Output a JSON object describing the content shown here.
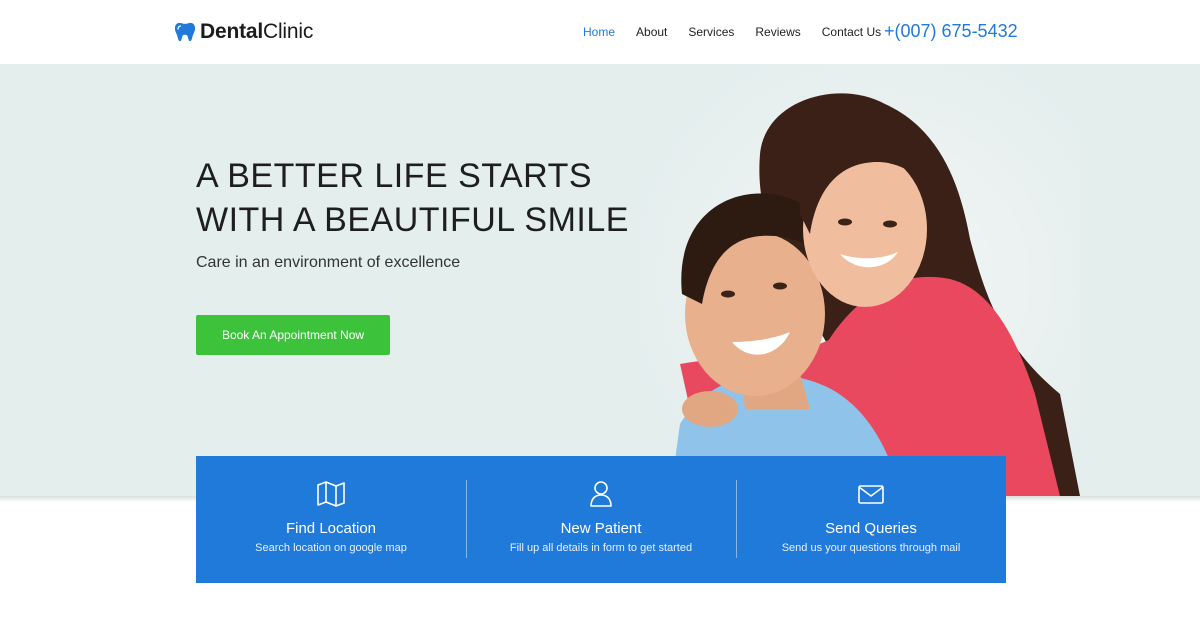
{
  "header": {
    "logo_bold": "Dental",
    "logo_light": "Clinic",
    "nav": [
      "Home",
      "About",
      "Services",
      "Reviews",
      "Contact Us"
    ],
    "phone": "+(007) 675-5432"
  },
  "hero": {
    "headline_line1": "A BETTER LIFE STARTS",
    "headline_line2": "WITH A BEAUTIFUL SMILE",
    "subline": "Care in an environment of excellence",
    "cta_label": "Book An Appointment Now"
  },
  "features": [
    {
      "icon": "map-icon",
      "title": "Find Location",
      "desc": "Search location on google map"
    },
    {
      "icon": "user-icon",
      "title": "New Patient",
      "desc": "Fill up all details in form to get started"
    },
    {
      "icon": "mail-icon",
      "title": "Send Queries",
      "desc": "Send us your questions through mail"
    }
  ],
  "colors": {
    "accent": "#1f7ad9",
    "cta": "#3cc23b",
    "hero_bg": "#e4eeed"
  }
}
